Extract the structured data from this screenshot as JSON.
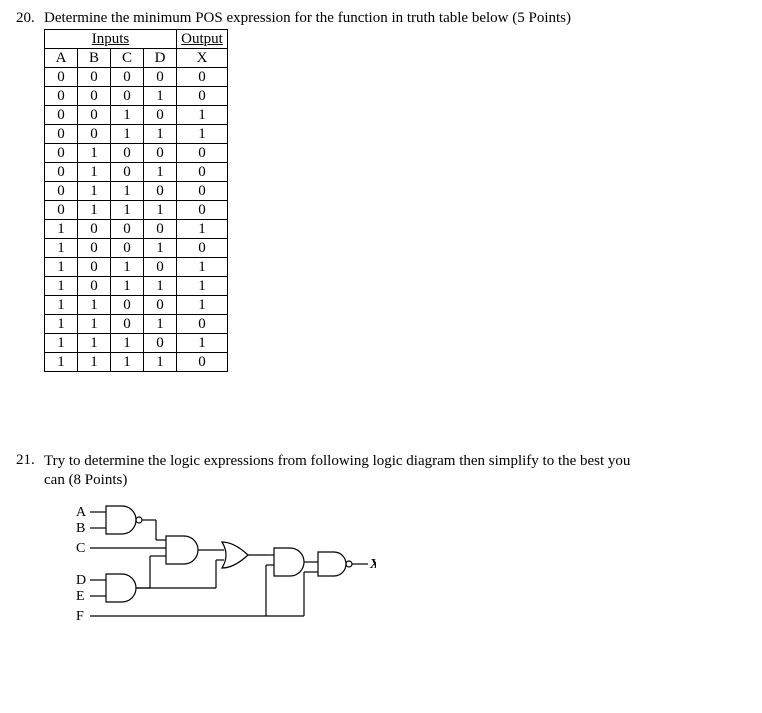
{
  "q20": {
    "number": "20.",
    "text": "Determine the minimum POS expression for the function in truth table below (5 Points)",
    "table": {
      "header_groups": {
        "inputs": "Inputs",
        "output": "Output"
      },
      "cols": [
        "A",
        "B",
        "C",
        "D",
        "X"
      ],
      "rows": [
        [
          "0",
          "0",
          "0",
          "0",
          "0"
        ],
        [
          "0",
          "0",
          "0",
          "1",
          "0"
        ],
        [
          "0",
          "0",
          "1",
          "0",
          "1"
        ],
        [
          "0",
          "0",
          "1",
          "1",
          "1"
        ],
        [
          "0",
          "1",
          "0",
          "0",
          "0"
        ],
        [
          "0",
          "1",
          "0",
          "1",
          "0"
        ],
        [
          "0",
          "1",
          "1",
          "0",
          "0"
        ],
        [
          "0",
          "1",
          "1",
          "1",
          "0"
        ],
        [
          "1",
          "0",
          "0",
          "0",
          "1"
        ],
        [
          "1",
          "0",
          "0",
          "1",
          "0"
        ],
        [
          "1",
          "0",
          "1",
          "0",
          "1"
        ],
        [
          "1",
          "0",
          "1",
          "1",
          "1"
        ],
        [
          "1",
          "1",
          "0",
          "0",
          "1"
        ],
        [
          "1",
          "1",
          "0",
          "1",
          "0"
        ],
        [
          "1",
          "1",
          "1",
          "0",
          "1"
        ],
        [
          "1",
          "1",
          "1",
          "1",
          "0"
        ]
      ]
    }
  },
  "q21": {
    "number": "21.",
    "text_line1": "Try to determine the logic expressions from following logic diagram then simplify to the best you",
    "text_line2": "can (8 Points)",
    "labels": {
      "A": "A",
      "B": "B",
      "C": "C",
      "D": "D",
      "E": "E",
      "F": "F",
      "X": "X"
    }
  }
}
